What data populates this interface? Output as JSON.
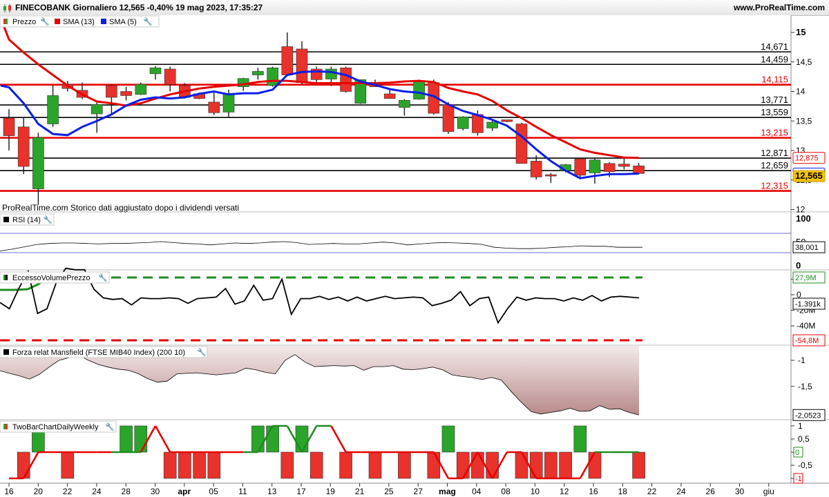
{
  "header": {
    "title": "FINECOBANK Giornaliero 12,565 -0,40% 19 mag 2023, 17:35:27",
    "site": "www.ProRealTime.com"
  },
  "colors": {
    "up": "#2aa52a",
    "down": "#e8322b",
    "sma13": "#e60000",
    "sma5": "#0a1ee6",
    "fill": "#d9b8b8"
  },
  "legends": {
    "price": "Prezzo",
    "sma13": "SMA (13)",
    "sma5": "SMA (5)",
    "rsi": "RSI (14)",
    "evp": "EccessoVolumePrezzo",
    "mansfield": "Forza relat Mansfield (FTSE MIB40 Index) (200 10)",
    "twobar": "TwoBarChartDailyWeekly"
  },
  "note": "ProRealTime.com Storico dati aggiustato dopo i dividendi versati",
  "chart_data": {
    "type": "candlestick",
    "xlabels": [
      "16",
      "20",
      "22",
      "24",
      "28",
      "30",
      "apr",
      "05",
      "11",
      "13",
      "17",
      "19",
      "21",
      "25",
      "27",
      "mag",
      "04",
      "08",
      "10",
      "12",
      "16",
      "18",
      "22",
      "24",
      "26",
      "30",
      "giu"
    ],
    "price_axis": [
      "15",
      "14,5",
      "14",
      "13,5",
      "13",
      "12,5",
      "12"
    ],
    "candles": [
      {
        "o": 13.55,
        "h": 13.7,
        "l": 13.0,
        "c": 13.25
      },
      {
        "o": 13.4,
        "h": 13.55,
        "l": 12.6,
        "c": 12.73
      },
      {
        "o": 12.35,
        "h": 13.3,
        "l": 12.08,
        "c": 13.22
      },
      {
        "o": 13.45,
        "h": 14.1,
        "l": 13.4,
        "c": 13.93
      },
      {
        "o": 14.12,
        "h": 14.18,
        "l": 14.0,
        "c": 14.05
      },
      {
        "o": 14.02,
        "h": 14.15,
        "l": 13.87,
        "c": 13.9
      },
      {
        "o": 13.62,
        "h": 13.83,
        "l": 13.3,
        "c": 13.78
      },
      {
        "o": 14.1,
        "h": 14.12,
        "l": 13.62,
        "c": 13.9
      },
      {
        "o": 14.0,
        "h": 14.08,
        "l": 13.85,
        "c": 13.93
      },
      {
        "o": 13.95,
        "h": 14.15,
        "l": 13.94,
        "c": 14.12
      },
      {
        "o": 14.3,
        "h": 14.43,
        "l": 14.2,
        "c": 14.4
      },
      {
        "o": 14.38,
        "h": 14.42,
        "l": 14.0,
        "c": 14.12
      },
      {
        "o": 14.1,
        "h": 14.14,
        "l": 13.88,
        "c": 13.9
      },
      {
        "o": 13.96,
        "h": 13.98,
        "l": 13.87,
        "c": 13.88
      },
      {
        "o": 13.82,
        "h": 13.98,
        "l": 13.6,
        "c": 13.64
      },
      {
        "o": 13.65,
        "h": 14.03,
        "l": 13.55,
        "c": 13.96
      },
      {
        "o": 14.08,
        "h": 14.23,
        "l": 14.01,
        "c": 14.22
      },
      {
        "o": 14.28,
        "h": 14.4,
        "l": 14.2,
        "c": 14.34
      },
      {
        "o": 14.1,
        "h": 14.42,
        "l": 14.08,
        "c": 14.4
      },
      {
        "o": 14.76,
        "h": 15.0,
        "l": 14.28,
        "c": 14.28
      },
      {
        "o": 14.72,
        "h": 14.85,
        "l": 14.12,
        "c": 14.15
      },
      {
        "o": 14.38,
        "h": 14.42,
        "l": 14.15,
        "c": 14.2
      },
      {
        "o": 14.21,
        "h": 14.42,
        "l": 14.09,
        "c": 14.38
      },
      {
        "o": 14.4,
        "h": 14.42,
        "l": 13.98,
        "c": 14.0
      },
      {
        "o": 13.8,
        "h": 14.2,
        "l": 13.79,
        "c": 14.2
      },
      {
        "o": 14.12,
        "h": 14.2,
        "l": 14.08,
        "c": 14.08
      },
      {
        "o": 13.96,
        "h": 14.03,
        "l": 13.9,
        "c": 13.88
      },
      {
        "o": 13.73,
        "h": 13.87,
        "l": 13.59,
        "c": 13.85
      },
      {
        "o": 13.87,
        "h": 14.2,
        "l": 13.86,
        "c": 14.18
      },
      {
        "o": 14.15,
        "h": 14.2,
        "l": 13.61,
        "c": 13.63
      },
      {
        "o": 13.78,
        "h": 13.82,
        "l": 13.28,
        "c": 13.32
      },
      {
        "o": 13.37,
        "h": 13.58,
        "l": 13.34,
        "c": 13.57
      },
      {
        "o": 13.61,
        "h": 13.68,
        "l": 13.25,
        "c": 13.3
      },
      {
        "o": 13.38,
        "h": 13.5,
        "l": 13.33,
        "c": 13.48
      },
      {
        "o": 13.52,
        "h": 13.52,
        "l": 13.48,
        "c": 13.49
      },
      {
        "o": 13.45,
        "h": 13.47,
        "l": 12.78,
        "c": 12.78
      },
      {
        "o": 12.82,
        "h": 12.92,
        "l": 12.51,
        "c": 12.55
      },
      {
        "o": 12.59,
        "h": 12.62,
        "l": 12.45,
        "c": 12.57
      },
      {
        "o": 12.66,
        "h": 12.77,
        "l": 12.63,
        "c": 12.76
      },
      {
        "o": 12.86,
        "h": 12.88,
        "l": 12.55,
        "c": 12.58
      },
      {
        "o": 12.62,
        "h": 12.88,
        "l": 12.44,
        "c": 12.84
      },
      {
        "o": 12.78,
        "h": 12.8,
        "l": 12.55,
        "c": 12.64
      },
      {
        "o": 12.77,
        "h": 12.86,
        "l": 12.68,
        "c": 12.73
      },
      {
        "o": 12.74,
        "h": 12.79,
        "l": 12.6,
        "c": 12.61
      }
    ],
    "sma13": [
      14.88,
      14.66,
      14.46,
      14.28,
      14.1,
      13.95,
      13.83,
      13.8,
      13.76,
      13.8,
      13.88,
      13.95,
      14.0,
      14.05,
      14.08,
      14.1,
      14.12,
      14.16,
      14.18,
      14.18,
      14.16,
      14.14,
      14.14,
      14.14,
      14.14,
      14.14,
      14.15,
      14.17,
      14.18,
      14.16,
      14.06,
      14.0,
      13.95,
      13.84,
      13.68,
      13.55,
      13.4,
      13.26,
      13.14,
      13.02,
      12.96,
      12.92,
      12.88,
      12.875
    ],
    "sma5": [
      14.07,
      13.8,
      13.45,
      13.28,
      13.26,
      13.4,
      13.5,
      13.61,
      13.76,
      13.86,
      13.9,
      13.88,
      13.9,
      13.96,
      14.0,
      13.95,
      13.97,
      13.97,
      14.03,
      14.28,
      14.33,
      14.34,
      14.33,
      14.28,
      14.17,
      14.11,
      14.04,
      14.0,
      13.98,
      13.92,
      13.78,
      13.67,
      13.6,
      13.52,
      13.42,
      13.24,
      13.02,
      12.82,
      12.66,
      12.53,
      12.57,
      12.6,
      12.6,
      12.608
    ],
    "levels": [
      {
        "value": 14.671,
        "label": "14,671",
        "color": "#000000"
      },
      {
        "value": 14.459,
        "label": "14,459",
        "color": "#000000"
      },
      {
        "value": 14.115,
        "label": "14,115",
        "color": "#e60000"
      },
      {
        "value": 13.771,
        "label": "13,771",
        "color": "#000000"
      },
      {
        "value": 13.559,
        "label": "13,559",
        "color": "#000000"
      },
      {
        "value": 13.215,
        "label": "13,215",
        "color": "#e60000"
      },
      {
        "value": 12.871,
        "label": "12,871",
        "color": "#000000"
      },
      {
        "value": 12.659,
        "label": "12,659",
        "color": "#000000"
      },
      {
        "value": 12.315,
        "label": "12,315",
        "color": "#e60000"
      }
    ],
    "price_badges": [
      {
        "label": "12,875",
        "value": 12.875,
        "border": "#e60000",
        "bg": "#ffffff",
        "text": "#e60000"
      },
      {
        "label": "12,608",
        "value": 12.608,
        "border": "#0a1ee6",
        "bg": "#ffffff",
        "text": "#0a1ee6"
      },
      {
        "label": "12,565",
        "value": 12.565,
        "border": "#c8a000",
        "bg": "#f2c100",
        "text": "#000000"
      }
    ],
    "rsi": {
      "axis": [
        "100",
        "50",
        "0"
      ],
      "values": [
        30,
        34,
        39,
        44,
        46,
        47,
        47,
        46,
        45,
        46,
        46,
        47,
        48,
        50,
        48,
        46,
        45,
        43,
        45,
        47,
        46,
        47,
        49,
        50,
        48,
        44,
        45,
        46,
        45,
        45,
        47,
        49,
        47,
        43,
        45,
        47,
        48,
        47,
        46,
        44,
        38,
        36,
        35,
        35,
        36,
        38,
        39,
        41,
        40,
        40,
        38,
        38,
        38
      ],
      "badge": "38,001"
    },
    "evp": {
      "axis": [
        "20M",
        "0",
        "-20M",
        "-40M"
      ],
      "upper_band": "27,9M",
      "lower_band": "-54,8M",
      "badge": "-1.391k",
      "values": [
        -10,
        -18,
        8,
        30,
        -24,
        -18,
        16,
        34,
        32,
        32,
        7,
        -4,
        -6,
        -5,
        -13,
        -4,
        -5,
        -5,
        -4,
        -5,
        -11,
        -5,
        -4,
        -3,
        8,
        -12,
        -8,
        12,
        -7,
        -5,
        20,
        -25,
        -5,
        -5,
        -2,
        -6,
        -3,
        -8,
        -3,
        -8,
        -5,
        -2,
        -5,
        -4,
        -3,
        -4,
        -14,
        -11,
        -7,
        4,
        -14,
        -5,
        -3,
        -36,
        -18,
        -3,
        -7,
        -4,
        -5,
        -5,
        -8,
        -4,
        -7,
        -1,
        -8,
        -3,
        -2,
        -3,
        -4
      ]
    },
    "mansfield": {
      "axis": [
        "-1",
        "-1,5",
        "-2"
      ],
      "badge": "-2,0523",
      "values": [
        -1.2,
        -1.25,
        -1.3,
        -1.36,
        -1.27,
        -1.13,
        -1.0,
        -0.95,
        -0.9,
        -1.0,
        -1.08,
        -1.13,
        -1.17,
        -1.19,
        -1.25,
        -1.35,
        -1.42,
        -1.4,
        -1.26,
        -1.25,
        -1.24,
        -1.26,
        -1.28,
        -1.26,
        -1.24,
        -1.15,
        -1.18,
        -1.23,
        -1.26,
        -1.0,
        -0.89,
        -1.03,
        -1.12,
        -1.11,
        -1.1,
        -1.11,
        -1.1,
        -1.19,
        -1.12,
        -1.12,
        -1.1,
        -1.17,
        -1.18,
        -1.16,
        -1.13,
        -1.18,
        -1.28,
        -1.31,
        -1.33,
        -1.37,
        -1.33,
        -1.38,
        -1.6,
        -1.8,
        -1.98,
        -2.03,
        -2.0,
        -1.97,
        -1.92,
        -1.98,
        -1.97,
        -1.87,
        -1.94,
        -1.93,
        -2.0,
        -2.05
      ]
    },
    "twobar": {
      "axis": [
        "1",
        "0,5",
        "0",
        "-0,5",
        "-1"
      ],
      "badges": [
        "0",
        "-1"
      ],
      "bars": [
        0,
        -1,
        1,
        0,
        -1,
        0,
        0,
        0,
        1,
        1,
        0,
        -1,
        -1,
        -1,
        -1,
        0,
        0,
        1,
        1,
        -1,
        1,
        -1,
        0,
        -1,
        0,
        -1,
        0,
        -1,
        0,
        -1,
        1,
        -1,
        -1,
        -1,
        0,
        -1,
        -1,
        -1,
        -1,
        1,
        -1,
        0,
        0,
        -1,
        0,
        0
      ],
      "line_up": [
        1,
        1,
        0,
        0,
        0,
        0,
        0,
        0,
        1,
        0,
        0,
        0,
        0,
        0,
        0,
        0,
        0,
        1,
        1,
        1,
        1,
        1,
        0,
        0,
        0,
        0,
        0,
        0,
        0,
        0,
        0,
        0,
        0,
        0,
        0,
        0,
        0,
        0,
        0,
        0,
        1,
        1,
        1,
        1
      ],
      "line": [
        -1,
        -1,
        0,
        0,
        0,
        0,
        0,
        0,
        0,
        0,
        1,
        0,
        0,
        0,
        0,
        0,
        0,
        0,
        1,
        1,
        0,
        1,
        1,
        0,
        0,
        0,
        0,
        0,
        0,
        0,
        -1,
        -1,
        0,
        -1,
        0,
        0,
        -1,
        -1,
        -1,
        -1,
        0,
        0,
        0,
        0
      ]
    }
  }
}
